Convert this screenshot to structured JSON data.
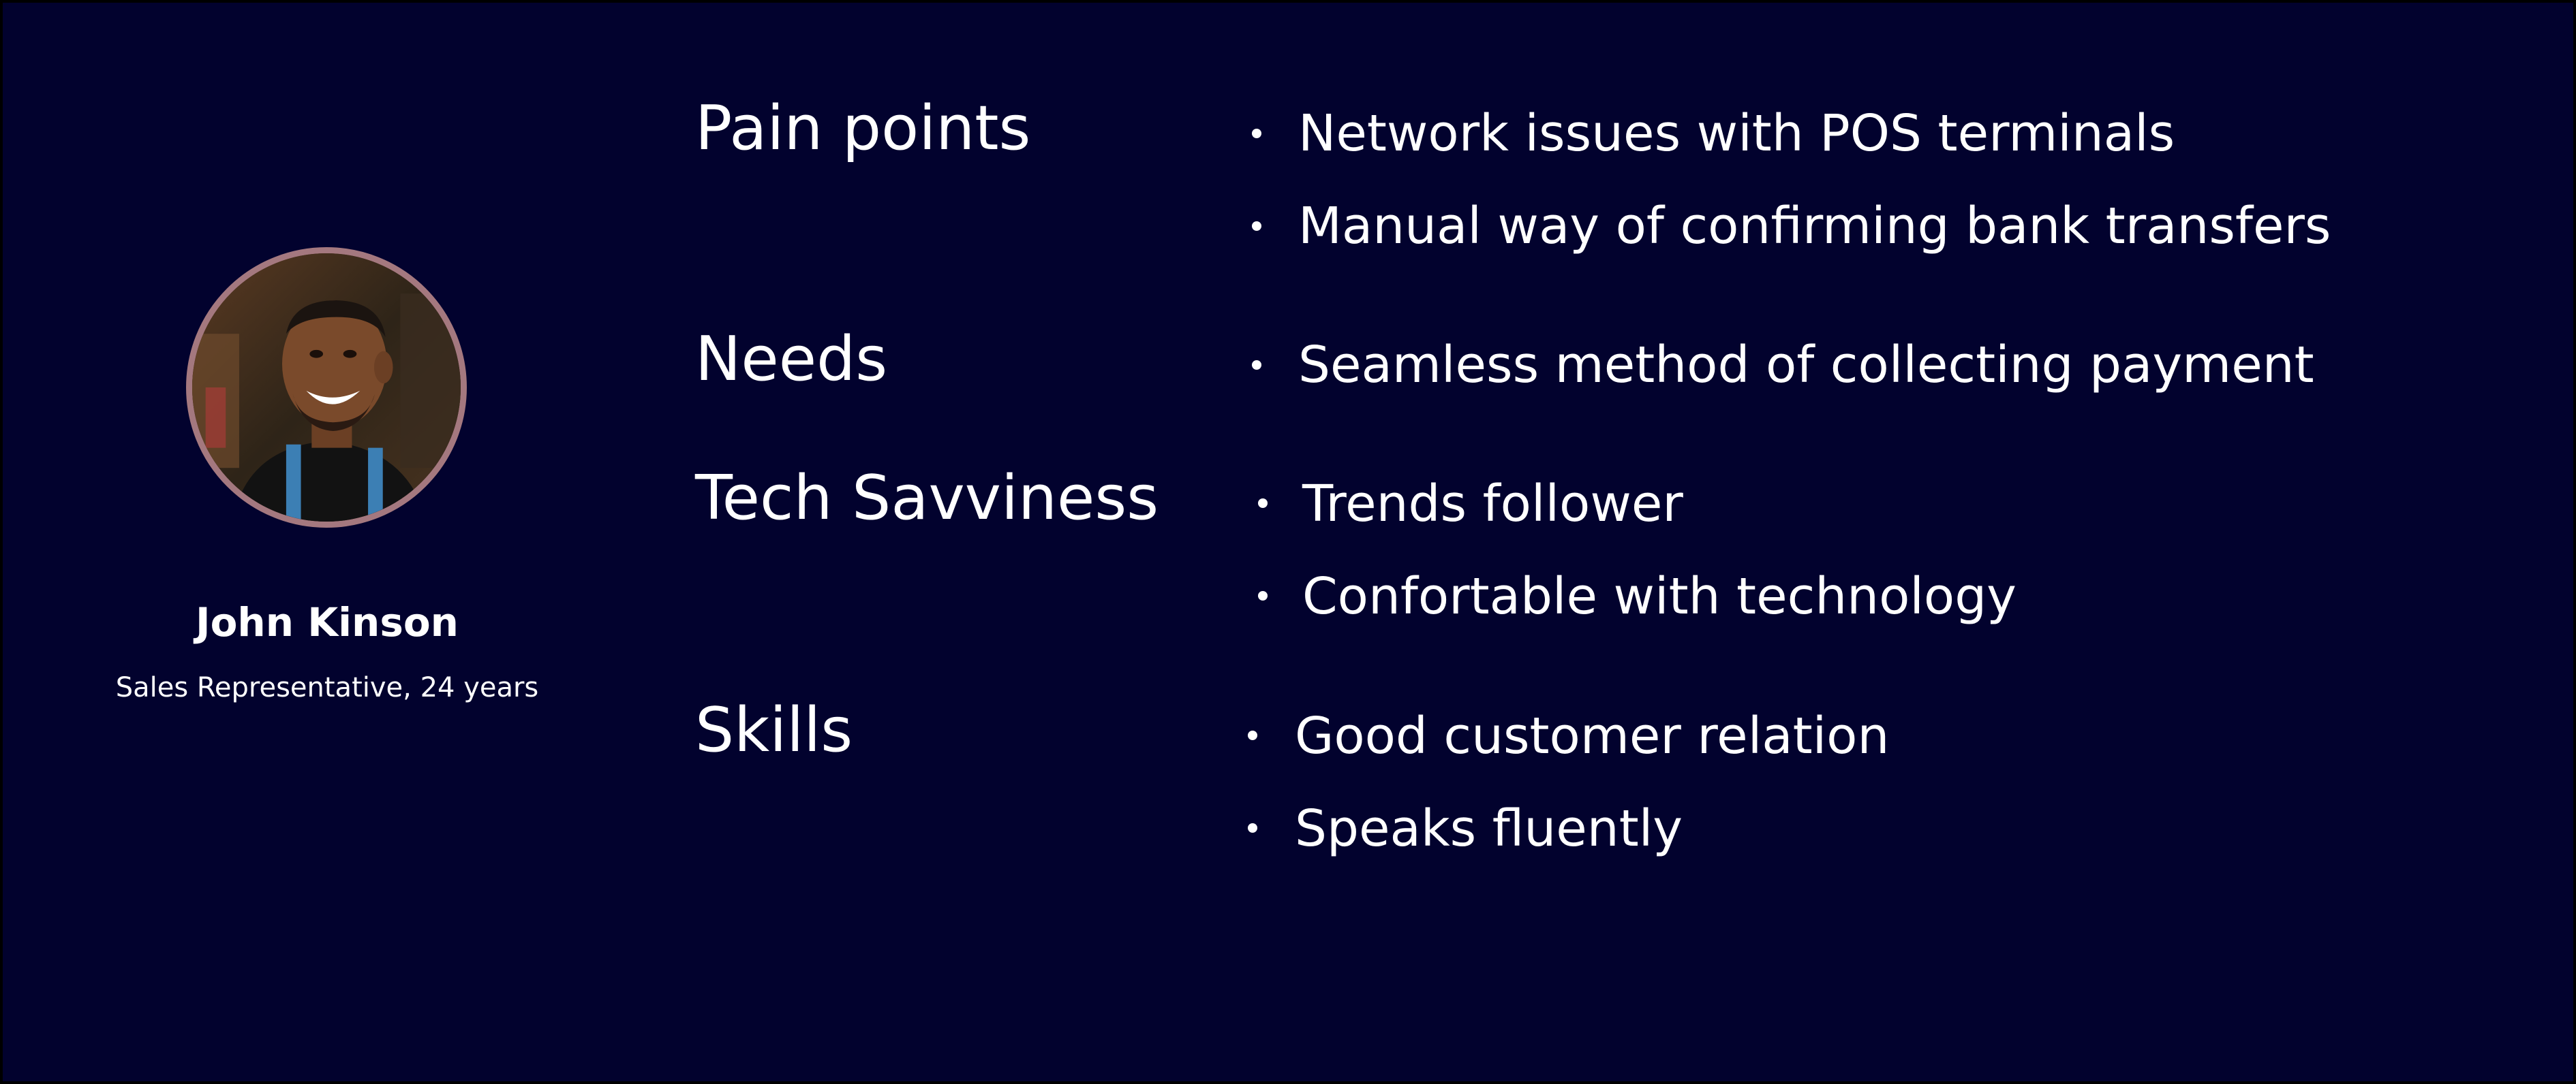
{
  "profile": {
    "name": "John Kinson",
    "role": "Sales Representative, 24 years"
  },
  "sections": [
    {
      "label": "Pain points",
      "items": [
        "Network issues with POS terminals",
        "Manual way of confirming bank transfers"
      ]
    },
    {
      "label": "Needs",
      "items": [
        "Seamless method of collecting payment"
      ]
    },
    {
      "label": "Tech Savviness",
      "items": [
        "Trends follower",
        "Confortable with technology"
      ]
    },
    {
      "label": "Skills",
      "items": [
        "Good customer relation",
        "Speaks fluently"
      ]
    }
  ],
  "colors": {
    "background": "#02022e",
    "text": "#ffffff",
    "avatar_ring": "#a4787f"
  }
}
